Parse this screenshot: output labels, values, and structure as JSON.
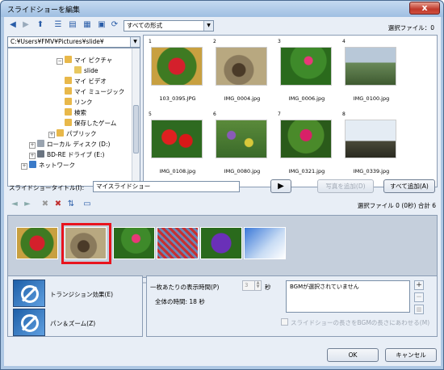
{
  "window": {
    "title": "スライドショーを編集",
    "close_label": "x"
  },
  "toolbar": {
    "filter_select": "すべての形式",
    "selected_count": "選択ファイル：0"
  },
  "path_select": "C:¥Users¥FMV¥Pictures¥slide¥",
  "tree": [
    {
      "label": "マイ ピクチャ",
      "icon": "folder-icon"
    },
    {
      "label": "slide",
      "icon": "folder-icon"
    },
    {
      "label": "マイ ビデオ",
      "icon": "folder-icon"
    },
    {
      "label": "マイ ミュージック",
      "icon": "folder-icon"
    },
    {
      "label": "リンク",
      "icon": "folder-icon"
    },
    {
      "label": "検索",
      "icon": "folder-icon"
    },
    {
      "label": "保存したゲーム",
      "icon": "folder-icon"
    },
    {
      "label": "パブリック",
      "icon": "folder-icon"
    },
    {
      "label": "ローカル ディスク (D:)",
      "icon": "drive-icon"
    },
    {
      "label": "BD-RE ドライブ (E:)",
      "icon": "drive-icon"
    },
    {
      "label": "ネットワーク",
      "icon": "network-icon"
    }
  ],
  "files": [
    {
      "num": "1",
      "name": "103_0395.JPG"
    },
    {
      "num": "2",
      "name": "IMG_0004.jpg"
    },
    {
      "num": "3",
      "name": "IMG_0006.jpg"
    },
    {
      "num": "4",
      "name": "IMG_0100.jpg"
    },
    {
      "num": "5",
      "name": "IMG_0108.jpg"
    },
    {
      "num": "6",
      "name": "IMG_0080.jpg"
    },
    {
      "num": "7",
      "name": "IMG_0321.jpg"
    },
    {
      "num": "8",
      "name": "IMG_0339.jpg"
    }
  ],
  "slideshow": {
    "title_label": "スライドショータイトル(I):",
    "title_value": "マイスライドショー",
    "add_selected_label": "写真を追加(D)",
    "add_all_label": "すべて追加(A)",
    "selected_info": "選択ファイル 0 (0秒) 合計 6"
  },
  "effects": {
    "transition_label": "トランジション効果(E)",
    "panzoom_label": "パン＆ズーム(Z)"
  },
  "timing": {
    "per_slide_label": "一枚あたりの表示時間(P)",
    "per_slide_value": "3",
    "seconds_unit": "秒",
    "total_time_label": "全体の時間: 18 秒"
  },
  "bgm": {
    "status": "BGMが選択されていません",
    "match_label": "スライドショーの長さをBGMの長さにあわせる(M)"
  },
  "footer": {
    "ok_label": "OK",
    "cancel_label": "キャンセル"
  }
}
